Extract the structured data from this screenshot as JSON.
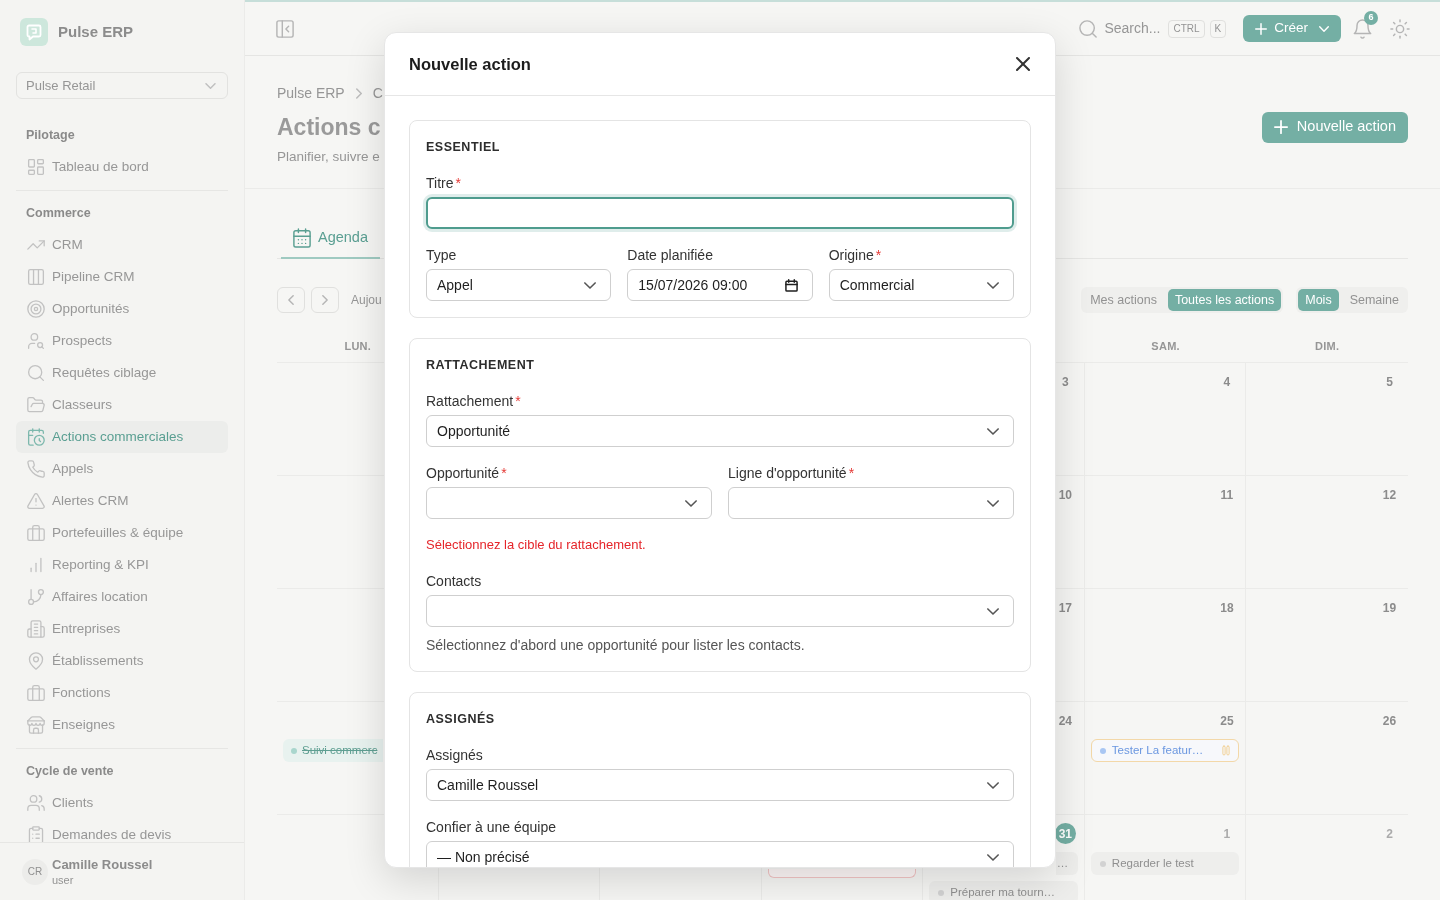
{
  "sidebar": {
    "app_name": "Pulse ERP",
    "workspace": "Pulse Retail",
    "sections": [
      {
        "title": "Pilotage",
        "items": [
          {
            "label": "Tableau de bord",
            "selected": false
          }
        ]
      },
      {
        "title": "Commerce",
        "items": [
          {
            "label": "CRM",
            "selected": false
          },
          {
            "label": "Pipeline CRM",
            "selected": false
          },
          {
            "label": "Opportunités",
            "selected": false
          },
          {
            "label": "Prospects",
            "selected": false
          },
          {
            "label": "Requêtes ciblage",
            "selected": false
          },
          {
            "label": "Classeurs",
            "selected": false
          },
          {
            "label": "Actions commerciales",
            "selected": true
          },
          {
            "label": "Appels",
            "selected": false
          },
          {
            "label": "Alertes CRM",
            "selected": false
          },
          {
            "label": "Portefeuilles & équipe",
            "selected": false
          },
          {
            "label": "Reporting & KPI",
            "selected": false
          },
          {
            "label": "Affaires location",
            "selected": false
          },
          {
            "label": "Entreprises",
            "selected": false
          },
          {
            "label": "Établissements",
            "selected": false
          },
          {
            "label": "Fonctions",
            "selected": false
          },
          {
            "label": "Enseignes",
            "selected": false
          }
        ]
      },
      {
        "title": "Cycle de vente",
        "items": [
          {
            "label": "Clients",
            "selected": false
          },
          {
            "label": "Demandes de devis",
            "selected": false
          }
        ]
      }
    ],
    "user": {
      "initials": "CR",
      "name": "Camille Roussel",
      "role": "user"
    }
  },
  "topbar": {
    "search_placeholder": "Search...",
    "shortcut_keys": [
      "CTRL",
      "K"
    ],
    "create_button": "Créer",
    "notification_count": "6"
  },
  "page": {
    "breadcrumb": [
      "Pulse ERP",
      "C"
    ],
    "title": "Actions c",
    "subtitle": "Planifier, suivre e",
    "new_button": "Nouvelle action",
    "tabs": [
      {
        "label": "Agenda",
        "selected": true
      }
    ],
    "today_button": "Aujou",
    "scope_filter": [
      {
        "label": "Mes actions",
        "selected": false
      },
      {
        "label": "Toutes les actions",
        "selected": true
      }
    ],
    "view_switch": [
      {
        "label": "Mois",
        "selected": true
      },
      {
        "label": "Semaine",
        "selected": false
      }
    ]
  },
  "calendar": {
    "weekdays": {
      "lun": "LUN.",
      "sam": "SAM.",
      "dim": "DIM."
    },
    "weeks": [
      {
        "ven": {
          "number": "3",
          "today": false,
          "other_month": false
        },
        "sam": {
          "number": "4",
          "today": false,
          "other_month": false
        },
        "dim": {
          "number": "5",
          "today": false,
          "other_month": false
        }
      },
      {
        "ven": {
          "number": "10",
          "today": false,
          "other_month": false
        },
        "sam": {
          "number": "11",
          "today": false,
          "other_month": false
        },
        "dim": {
          "number": "12",
          "today": false,
          "other_month": false
        }
      },
      {
        "ven": {
          "number": "17",
          "today": false,
          "other_month": false
        },
        "sam": {
          "number": "18",
          "today": false,
          "other_month": false
        },
        "dim": {
          "number": "19",
          "today": false,
          "other_month": false
        }
      },
      {
        "lun": {
          "events": [
            {
              "kind": "chip_start",
              "title": "Suivi commerc",
              "color": "#a9d6cd",
              "done": true,
              "paused": false,
              "overdue": false
            }
          ]
        },
        "ven": {
          "number": "24",
          "today": false,
          "other_month": false
        },
        "sam": {
          "number": "25",
          "today": false,
          "other_month": false,
          "events": [
            {
              "kind": "chip",
              "title": "Tester La featur…",
              "color": "#a9c6f3",
              "done": false,
              "paused": true,
              "overdue": false
            }
          ]
        },
        "dim": {
          "number": "26",
          "today": false,
          "other_month": false
        }
      },
      {
        "jeu": {
          "events": [
            {
              "kind": "chip_bottom",
              "overdue": true
            }
          ]
        },
        "ven": {
          "number": "31",
          "today": true,
          "other_month": false,
          "events": [
            {
              "kind": "chip_end",
              "title": "…",
              "done": false,
              "paused": false,
              "overdue": false
            },
            {
              "kind": "chip",
              "title": "Préparer ma tourn…",
              "color": "#d2d2d2",
              "done": false,
              "paused": false,
              "overdue": false
            }
          ]
        },
        "sam": {
          "number": "1",
          "today": false,
          "other_month": true,
          "events": [
            {
              "kind": "chip",
              "title": "Regarder le test",
              "color": "#d2d2d2",
              "done": false,
              "paused": false,
              "overdue": false
            }
          ]
        },
        "dim": {
          "number": "2",
          "today": false,
          "other_month": true
        }
      }
    ]
  },
  "dialog": {
    "title": "Nouvelle action",
    "required_marker": "*",
    "sections": [
      {
        "heading": "ESSENTIEL",
        "items": [
          {
            "kind": "fields",
            "fields": [
              {
                "kind": "text",
                "label": "Titre",
                "required": true,
                "focused": true
              }
            ]
          },
          {
            "kind": "fields",
            "fields": [
              {
                "kind": "select",
                "label": "Type",
                "required": false,
                "focused": false,
                "value": "Appel"
              },
              {
                "kind": "datetime",
                "label": "Date planifiée",
                "required": false,
                "focused": false,
                "value": "15/07/2026 09:00"
              },
              {
                "kind": "select",
                "label": "Origine",
                "required": true,
                "focused": false,
                "value": "Commercial"
              }
            ]
          }
        ]
      },
      {
        "heading": "RATTACHEMENT",
        "items": [
          {
            "kind": "fields",
            "fields": [
              {
                "kind": "select",
                "label": "Rattachement",
                "required": true,
                "focused": false,
                "value": "Opportunité"
              }
            ]
          },
          {
            "kind": "fields",
            "fields": [
              {
                "kind": "select",
                "label": "Opportunité",
                "required": true,
                "focused": false
              },
              {
                "kind": "select",
                "label": "Ligne d'opportunité",
                "required": true,
                "focused": false
              }
            ]
          },
          {
            "kind": "error",
            "text": "Sélectionnez la cible du rattachement."
          },
          {
            "kind": "fields",
            "fields": [
              {
                "kind": "select",
                "label": "Contacts",
                "required": false,
                "focused": false
              }
            ]
          },
          {
            "kind": "help",
            "text": "Sélectionnez d'abord une opportunité pour lister les contacts."
          }
        ]
      },
      {
        "heading": "ASSIGNÉS",
        "items": [
          {
            "kind": "fields",
            "fields": [
              {
                "kind": "select",
                "label": "Assignés",
                "required": false,
                "focused": false,
                "value": "Camille Roussel"
              }
            ]
          },
          {
            "kind": "fields",
            "fields": [
              {
                "kind": "select",
                "label": "Confier à une équipe",
                "required": false,
                "focused": false,
                "value": "— Non précisé"
              }
            ]
          }
        ]
      }
    ]
  }
}
